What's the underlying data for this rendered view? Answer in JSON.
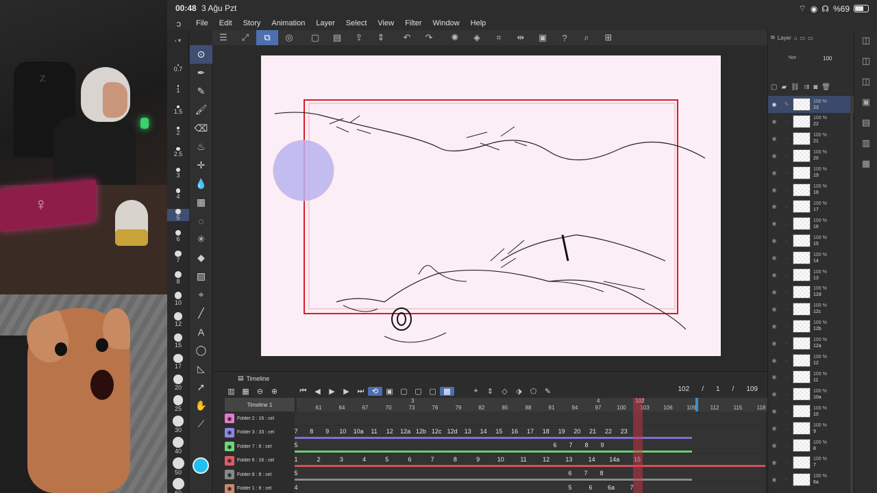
{
  "status": {
    "time": "00:48",
    "date": "3 Ağu Pzt",
    "battery": "%69",
    "battery_level": 0.69
  },
  "menu": {
    "items": [
      "File",
      "Edit",
      "Story",
      "Animation",
      "Layer",
      "Select",
      "View",
      "Filter",
      "Window",
      "Help"
    ]
  },
  "icons": {
    "app": "clip-studio-icon",
    "wifi": "wifi-icon",
    "orientation": "orientation-lock-icon",
    "headphones": "headphones-icon"
  },
  "brush_sizes": [
    "0.7",
    "1",
    "1.5",
    "2",
    "2.5",
    "3",
    "4",
    "5",
    "6",
    "7",
    "8",
    "10",
    "12",
    "15",
    "17",
    "20",
    "25",
    "30",
    "40",
    "50",
    "60"
  ],
  "brush_size_selected": "5",
  "timeline": {
    "tab_label": "Timeline",
    "name": "Timeline 1",
    "current_frame": "102",
    "sep1": "/",
    "page": "1",
    "sep2": "/",
    "total_frames": "109",
    "seconds": [
      "3",
      "4"
    ],
    "playhead_label": "102",
    "frame_numbers": [
      "61",
      "64",
      "67",
      "70",
      "73",
      "76",
      "79",
      "82",
      "85",
      "88",
      "91",
      "94",
      "97",
      "100",
      "103",
      "106",
      "109",
      "112",
      "115",
      "118"
    ],
    "tracks": [
      {
        "name": "Folder 2 : 16 : cel",
        "color": "#e07ad0",
        "cells": [],
        "bar": ""
      },
      {
        "name": "Folder 3 : 33 : cel",
        "color": "#8b87e8",
        "cells": [
          "7",
          "8",
          "9",
          "10",
          "10a",
          "11",
          "12",
          "12a",
          "12b",
          "12c",
          "12d",
          "13",
          "14",
          "15",
          "16",
          "17",
          "18",
          "19",
          "20",
          "21",
          "22",
          "23"
        ],
        "bar": "#7b73d6"
      },
      {
        "name": "Folder 7 : 9 : cel",
        "color": "#6dd678",
        "cells": [
          "5",
          "6",
          "7",
          "8",
          "9"
        ],
        "bar": "#6ccf6f"
      },
      {
        "name": "Folder 6 : 16 : cel",
        "color": "#e05a64",
        "cells": [
          "1",
          "2",
          "3",
          "4",
          "5",
          "6",
          "7",
          "8",
          "9",
          "10",
          "11",
          "12",
          "13",
          "14",
          "14a",
          "15"
        ],
        "bar": "#d4505a"
      },
      {
        "name": "Folder 8 : 8 : cel",
        "color": "#888888",
        "cells": [
          "5",
          "6",
          "7",
          "8"
        ],
        "bar": "#8a8a8a"
      },
      {
        "name": "Folder 1 : 9 : cel",
        "color": "#c98a6a",
        "cells": [
          "4",
          "5",
          "6",
          "6a",
          "7"
        ],
        "bar": "#b97a5e"
      }
    ]
  },
  "layers": {
    "panel_label": "Layer",
    "blend_mode": "Nor",
    "opacity": "100",
    "items": [
      {
        "opacity": "100 %",
        "name": "23",
        "selected": true
      },
      {
        "opacity": "100 %",
        "name": "22"
      },
      {
        "opacity": "100 %",
        "name": "21"
      },
      {
        "opacity": "100 %",
        "name": "20"
      },
      {
        "opacity": "100 %",
        "name": "19"
      },
      {
        "opacity": "100 %",
        "name": "18"
      },
      {
        "opacity": "100 %",
        "name": "17"
      },
      {
        "opacity": "100 %",
        "name": "16"
      },
      {
        "opacity": "100 %",
        "name": "15"
      },
      {
        "opacity": "100 %",
        "name": "14"
      },
      {
        "opacity": "100 %",
        "name": "13"
      },
      {
        "opacity": "100 %",
        "name": "12d"
      },
      {
        "opacity": "100 %",
        "name": "12c"
      },
      {
        "opacity": "100 %",
        "name": "12b"
      },
      {
        "opacity": "100 %",
        "name": "12a"
      },
      {
        "opacity": "100 %",
        "name": "12"
      },
      {
        "opacity": "100 %",
        "name": "11"
      },
      {
        "opacity": "100 %",
        "name": "10a"
      },
      {
        "opacity": "100 %",
        "name": "10"
      },
      {
        "opacity": "100 %",
        "name": "9"
      },
      {
        "opacity": "100 %",
        "name": "8"
      },
      {
        "opacity": "100 %",
        "name": "7"
      },
      {
        "opacity": "100 %",
        "name": "6a"
      }
    ]
  },
  "colors": {
    "accent": "#4d6fb0",
    "frame_border": "#d81c2a",
    "canvas_bg": "#fbeef6",
    "current_color": "#20c0f0"
  }
}
